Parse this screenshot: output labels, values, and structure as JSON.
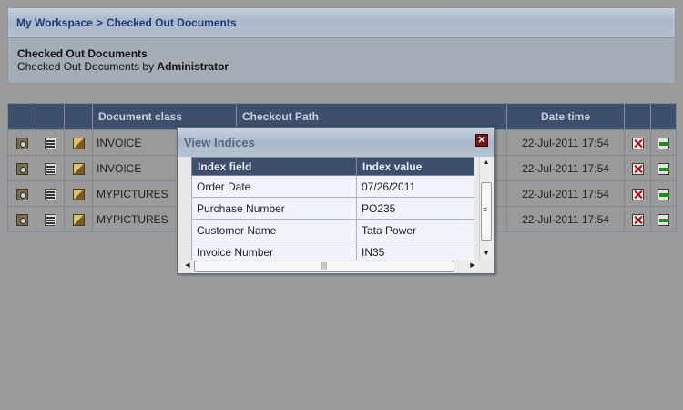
{
  "breadcrumb": {
    "root": "My Workspace",
    "separator": ">",
    "current": "Checked Out Documents"
  },
  "info": {
    "title": "Checked Out Documents",
    "subtitle_prefix": "Checked Out Documents by",
    "user": "Administrator"
  },
  "grid": {
    "headers": {
      "document_class": "Document class",
      "checkout_path": "Checkout Path",
      "date_time": "Date time"
    },
    "rows": [
      {
        "document_class": "INVOICE",
        "checkout_path": "",
        "date_time": "22-Jul-2011 17:54"
      },
      {
        "document_class": "INVOICE",
        "checkout_path": "",
        "date_time": "22-Jul-2011 17:54"
      },
      {
        "document_class": "MYPICTURES",
        "checkout_path": "",
        "date_time": "22-Jul-2011 17:54"
      },
      {
        "document_class": "MYPICTURES",
        "checkout_path": "",
        "date_time": "22-Jul-2011 17:54"
      }
    ],
    "row_icons": [
      "view-document-icon",
      "view-indices-icon",
      "document-history-icon",
      "undo-checkout-icon",
      "checkin-icon"
    ]
  },
  "dialog": {
    "title": "View Indices",
    "close_icon": "close-icon",
    "headers": {
      "field": "Index field",
      "value": "Index value"
    },
    "rows": [
      {
        "field": "Order Date",
        "value": "07/26/2011"
      },
      {
        "field": "Purchase Number",
        "value": "PO235"
      },
      {
        "field": "Customer Name",
        "value": "Tata Power"
      },
      {
        "field": "Invoice Number",
        "value": "IN35"
      }
    ]
  },
  "colors": {
    "overlay": "#9c9c9c",
    "header_bg": "#3d4f6b",
    "breadcrumb_text": "#1d3a7a",
    "close_button": "#7b1010"
  }
}
